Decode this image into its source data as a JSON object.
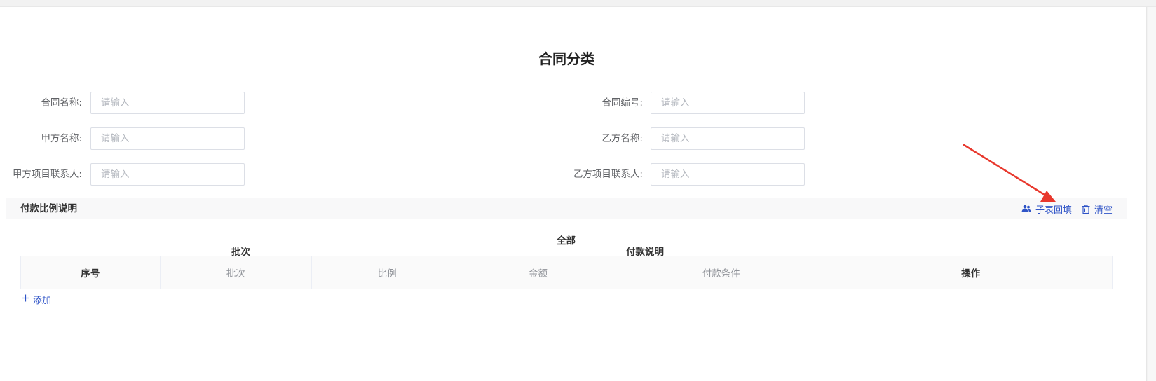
{
  "form": {
    "title": "合同分类",
    "fields": [
      {
        "label": "合同名称:",
        "placeholder": "请输入"
      },
      {
        "label": "合同编号:",
        "placeholder": "请输入"
      },
      {
        "label": "甲方名称:",
        "placeholder": "请输入"
      },
      {
        "label": "乙方名称:",
        "placeholder": "请输入"
      },
      {
        "label": "甲方项目联系人:",
        "placeholder": "请输入"
      },
      {
        "label": "乙方项目联系人:",
        "placeholder": "请输入"
      }
    ]
  },
  "section": {
    "title": "付款比例说明",
    "actions": {
      "backfill_label": "子表回填",
      "clear_label": "清空"
    }
  },
  "table": {
    "group_all": "全部",
    "group_batch": "批次",
    "group_payment_desc": "付款说明",
    "columns": [
      "序号",
      "批次",
      "比例",
      "金额",
      "付款条件",
      "操作"
    ]
  },
  "add_label": "添加",
  "colors": {
    "accent": "#2f54c7",
    "annotation_arrow": "#e8382d"
  }
}
